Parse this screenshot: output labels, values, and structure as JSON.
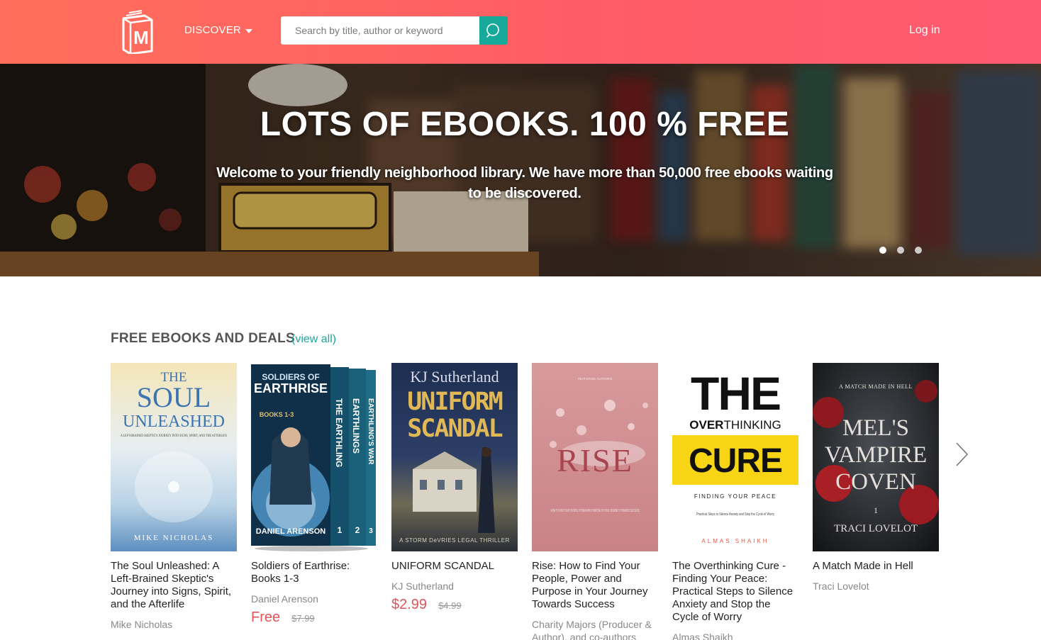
{
  "header": {
    "logo_letter": "M",
    "discover_label": "DISCOVER",
    "search_placeholder": "Search by title, author or keyword",
    "search_value": "",
    "login_label": "Log in"
  },
  "hero": {
    "title": "LOTS OF EBOOKS. 100 % FREE",
    "subtitle": "Welcome to your friendly neighborhood library. We have more than 50,000 free ebooks waiting to be discovered.",
    "slide_count": 3,
    "active_slide": 1
  },
  "section": {
    "title": "FREE EBOOKS AND DEALS",
    "view_all": "(view all)"
  },
  "books": [
    {
      "title": "The Soul Unleashed: A Left-Brained Skeptic's Journey into Signs, Spirit, and the Afterlife",
      "author": "Mike Nicholas",
      "price": "",
      "old_price": "",
      "cover": {
        "line1": "THE",
        "line2": "SOUL",
        "line3": "UNLEASHED",
        "tagline": "A LEFT-BRAINED SKEPTIC'S JOURNEY INTO SIGNS, SPIRIT, AND THE AFTERLIFE",
        "author": "MIKE NICHOLAS"
      }
    },
    {
      "title": "Soldiers of Earthrise: Books 1-3",
      "author": "Daniel Arenson",
      "price": "Free",
      "old_price": "$7.99",
      "cover": {
        "series": "SOLDIERS OF EARTHRISE",
        "books": "BOOKS 1-3",
        "spine1": "THE EARTHLING",
        "spine2": "EARTHLINGS",
        "spine3": "EARTHLING'S WAR",
        "author": "DANIEL ARENSON"
      }
    },
    {
      "title": "UNIFORM SCANDAL",
      "author": "KJ Sutherland",
      "price": "$2.99",
      "old_price": "$4.99",
      "cover": {
        "author": "KJ Sutherland",
        "line1": "UNIFORM",
        "line2": "SCANDAL",
        "tagline": "A STORM DeVRIES LEGAL THRILLER"
      }
    },
    {
      "title": "Rise: How to Find Your People, Power and Purpose in Your Journey Towards Success",
      "author": "Charity Majors (Producer & Author), and co-authors",
      "price": "",
      "old_price": "",
      "cover": {
        "word": "RISE",
        "tagline": "HOW TO FIND YOUR PEOPLE, POWER AND PURPOSE IN YOUR JOURNEY TOWARDS SUCCESS"
      }
    },
    {
      "title": "The Overthinking Cure - Finding Your Peace: Practical Steps to Silence Anxiety and Stop the Cycle of Worry",
      "author": "Almas Shaikh",
      "price": "",
      "old_price": "",
      "cover": {
        "line1": "THE",
        "line2a": "OVER",
        "line2b": "THINKING",
        "line3": "CURE",
        "tagline": "FINDING YOUR PEACE",
        "sub": "Practical Steps to Silence Anxiety and Stop the Cycle of Worry",
        "author": "ALMAS SHAIKH"
      }
    },
    {
      "title": "A Match Made in Hell",
      "author": "Traci Lovelot",
      "price": "",
      "old_price": "",
      "cover": {
        "top": "A MATCH MADE IN HELL",
        "line1": "MEL'S",
        "line2": "VAMPIRE",
        "line3": "COVEN",
        "number": "1",
        "author": "TRACI LOVELOT"
      }
    }
  ],
  "colors": {
    "header_start": "#ff6f5a",
    "header_end": "#ff5a70",
    "accent_teal": "#17a99a",
    "price_red": "#e0555a"
  },
  "icons": {
    "search": "search-icon",
    "next": "chevron-right-icon",
    "discover": "caret-down-icon"
  }
}
